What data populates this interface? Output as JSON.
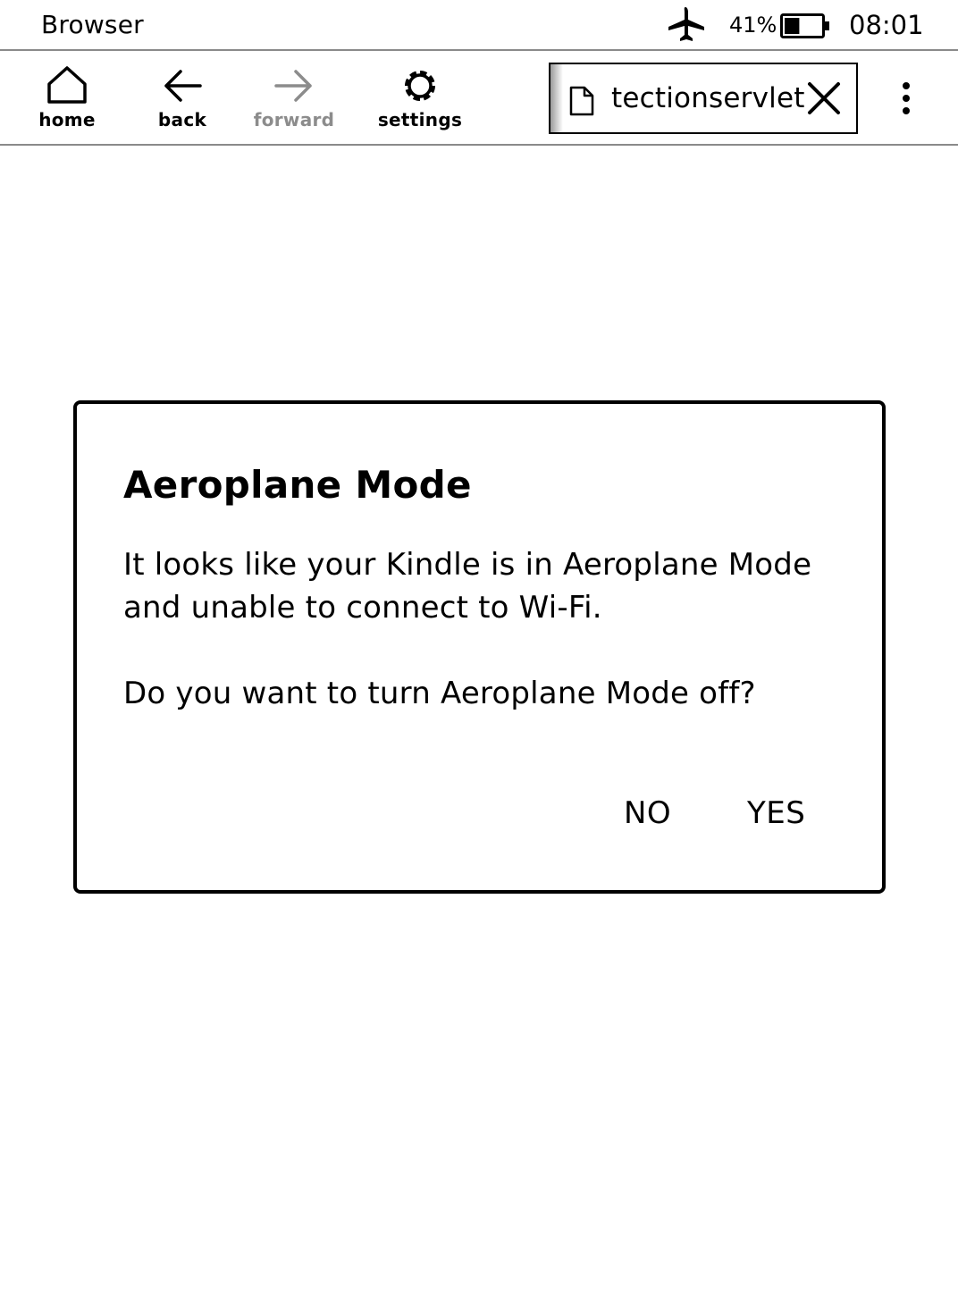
{
  "status_bar": {
    "app_title": "Browser",
    "airplane_icon": "airplane-icon",
    "battery_percent": "41%",
    "battery_level": 0.41,
    "time": "08:01"
  },
  "toolbar": {
    "home_label": "home",
    "back_label": "back",
    "forward_label": "forward",
    "settings_label": "settings",
    "forward_disabled_color": "#8c8c8c",
    "tab": {
      "title": "tectionservlet",
      "icon": "page-icon",
      "close_icon": "close-icon"
    },
    "menu_icon": "more-vertical-icon"
  },
  "dialog": {
    "title": "Aeroplane Mode",
    "message": "It looks like your Kindle is in Aeroplane Mode and unable to connect to Wi-Fi.",
    "question": "Do you want to turn Aeroplane Mode off?",
    "no_label": "NO",
    "yes_label": "YES"
  }
}
